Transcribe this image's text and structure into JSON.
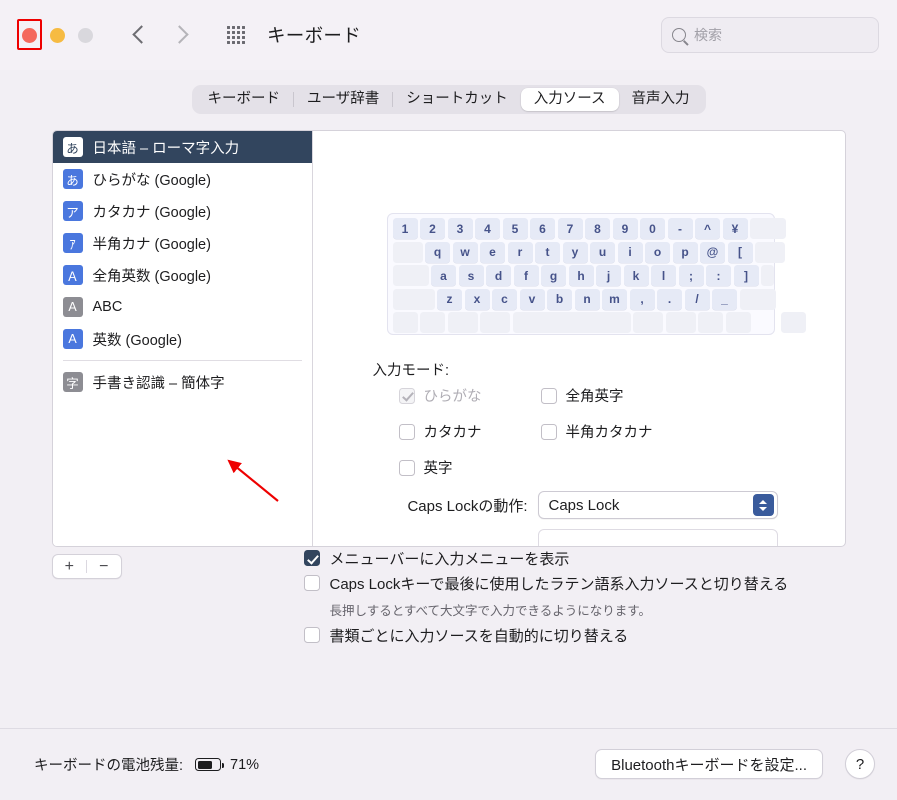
{
  "window": {
    "title": "キーボード",
    "search_placeholder": "検索"
  },
  "tabs": [
    {
      "label": "キーボード",
      "selected": false
    },
    {
      "label": "ユーザ辞書",
      "selected": false
    },
    {
      "label": "ショートカット",
      "selected": false
    },
    {
      "label": "入力ソース",
      "selected": true
    },
    {
      "label": "音声入力",
      "selected": false
    }
  ],
  "input_sources": [
    {
      "badge": "あ",
      "label": "日本語 – ローマ字入力",
      "badge_style": "white",
      "selected": true
    },
    {
      "badge": "あ",
      "label": "ひらがな (Google)",
      "badge_style": "blue",
      "selected": false
    },
    {
      "badge": "ア",
      "label": "カタカナ (Google)",
      "badge_style": "blue",
      "selected": false
    },
    {
      "badge": "ｱ",
      "label": "半角カナ (Google)",
      "badge_style": "blue",
      "selected": false
    },
    {
      "badge": "Ａ",
      "label": "全角英数 (Google)",
      "badge_style": "blue",
      "selected": false
    },
    {
      "badge": "A",
      "label": "ABC",
      "badge_style": "gray",
      "selected": false
    },
    {
      "badge": "A",
      "label": "英数 (Google)",
      "badge_style": "blue",
      "selected": false
    },
    {
      "badge": "字",
      "label": "手書き認識 – 簡体字",
      "badge_style": "gray",
      "selected": false
    }
  ],
  "list_buttons": {
    "add": "+",
    "remove": "−"
  },
  "keyboard_preview": {
    "rows": [
      [
        "1",
        "2",
        "3",
        "4",
        "5",
        "6",
        "7",
        "8",
        "9",
        "0",
        "-",
        "^",
        "¥"
      ],
      [
        "q",
        "w",
        "e",
        "r",
        "t",
        "y",
        "u",
        "i",
        "o",
        "p",
        "@",
        "["
      ],
      [
        "a",
        "s",
        "d",
        "f",
        "g",
        "h",
        "j",
        "k",
        "l",
        ";",
        ":",
        "]"
      ],
      [
        "z",
        "x",
        "c",
        "v",
        "b",
        "n",
        "m",
        ",",
        ".",
        "/",
        "_"
      ]
    ]
  },
  "input_mode": {
    "label": "入力モード:",
    "options": [
      {
        "label": "ひらがな",
        "checked": true,
        "disabled": true
      },
      {
        "label": "全角英字",
        "checked": false,
        "disabled": false
      },
      {
        "label": "カタカナ",
        "checked": false,
        "disabled": false
      },
      {
        "label": "半角カタカナ",
        "checked": false,
        "disabled": false
      },
      {
        "label": "英字",
        "checked": false,
        "disabled": false
      }
    ]
  },
  "caps_lock": {
    "label": "Caps Lockの動作:",
    "value": "Caps Lock"
  },
  "options": [
    {
      "label": "メニューバーに入力メニューを表示",
      "checked": true,
      "sub": ""
    },
    {
      "label": "Caps Lockキーで最後に使用したラテン語系入力ソースと切り替える",
      "checked": false,
      "sub": "長押しするとすべて大文字で入力できるようになります。"
    },
    {
      "label": "書類ごとに入力ソースを自動的に切り替える",
      "checked": false,
      "sub": ""
    }
  ],
  "footer": {
    "battery_label": "キーボードの電池残量:",
    "battery_percent": "71%",
    "battery_level": 71,
    "bluetooth_button": "Bluetoothキーボードを設定...",
    "help_button": "?"
  },
  "colors": {
    "selection": "#32455e",
    "badge_blue": "#4a77de",
    "badge_gray": "#8d8d93",
    "annotation": "#ee0000"
  }
}
